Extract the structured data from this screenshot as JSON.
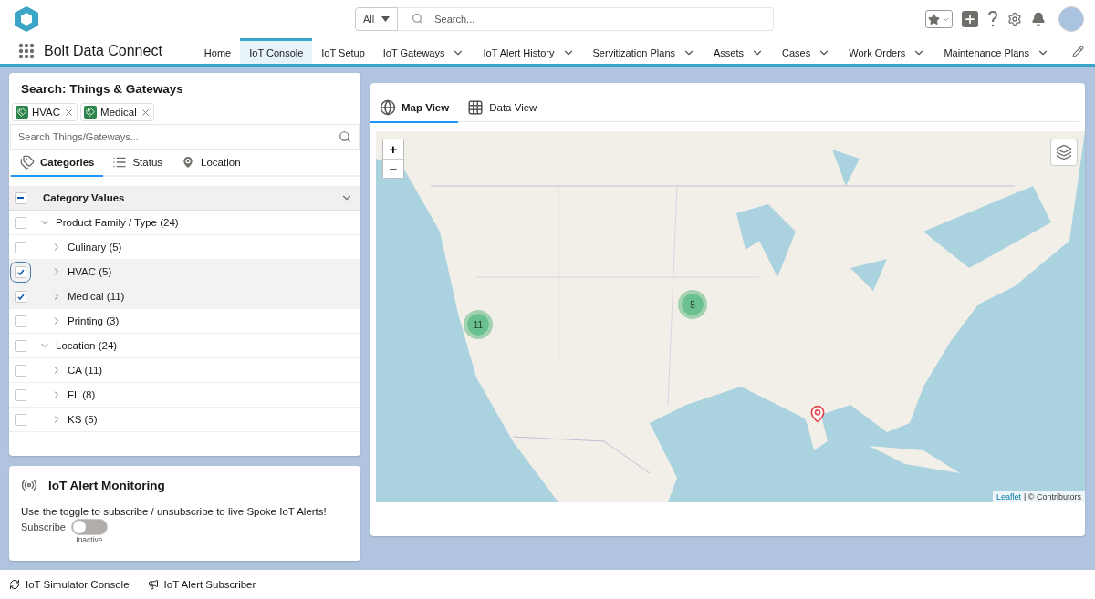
{
  "header": {
    "scope": "All",
    "search_placeholder": "Search..."
  },
  "app_name": "Bolt Data Connect",
  "nav_tabs": [
    {
      "label": "Home",
      "selected": false,
      "has_menu": false
    },
    {
      "label": "IoT Console",
      "selected": true,
      "has_menu": false
    },
    {
      "label": "IoT Setup",
      "selected": false,
      "has_menu": false
    },
    {
      "label": "IoT Gateways",
      "selected": false,
      "has_menu": true
    },
    {
      "label": "IoT Alert History",
      "selected": false,
      "has_menu": true
    },
    {
      "label": "Servitization Plans",
      "selected": false,
      "has_menu": true
    },
    {
      "label": "Assets",
      "selected": false,
      "has_menu": true
    },
    {
      "label": "Cases",
      "selected": false,
      "has_menu": true
    },
    {
      "label": "Work Orders",
      "selected": false,
      "has_menu": true
    },
    {
      "label": "Maintenance Plans",
      "selected": false,
      "has_menu": true
    }
  ],
  "search_panel": {
    "title": "Search: Things & Gateways",
    "pills": [
      {
        "label": "HVAC"
      },
      {
        "label": "Medical"
      }
    ],
    "placeholder": "Search Things/Gateways...",
    "tabs": [
      {
        "label": "Categories",
        "kind": "categories",
        "selected": true
      },
      {
        "label": "Status",
        "kind": "status",
        "selected": false
      },
      {
        "label": "Location",
        "kind": "location",
        "selected": false
      }
    ],
    "tree_header": {
      "label": "Category Values",
      "indeterminate": true,
      "expanded": true
    },
    "tree": [
      {
        "label": "Product Family / Type (24)",
        "checked": false,
        "expanded": true,
        "children": [
          {
            "label": "Culinary (5)",
            "checked": false,
            "expanded": false
          },
          {
            "label": "HVAC (5)",
            "checked": true,
            "expanded": false
          },
          {
            "label": "Medical (11)",
            "checked": true,
            "expanded": false
          },
          {
            "label": "Printing (3)",
            "checked": false,
            "expanded": false
          }
        ]
      },
      {
        "label": "Location (24)",
        "checked": false,
        "expanded": true,
        "children": [
          {
            "label": "CA (11)",
            "checked": false,
            "expanded": false
          },
          {
            "label": "FL (8)",
            "checked": false,
            "expanded": false
          },
          {
            "label": "KS (5)",
            "checked": false,
            "expanded": false
          }
        ]
      }
    ]
  },
  "alert_card": {
    "title": "IoT Alert Monitoring",
    "text": "Use the toggle to subscribe / unsubscribe to live Spoke IoT Alerts!",
    "toggle_label": "Subscribe",
    "on": false,
    "status": "Inactive"
  },
  "map_panel": {
    "tabs": [
      {
        "label": "Map View",
        "kind": "map",
        "selected": true
      },
      {
        "label": "Data View",
        "kind": "data",
        "selected": false
      }
    ],
    "zoom_in": "+",
    "zoom_out": "−",
    "clusters": [
      {
        "count": "11"
      },
      {
        "count": "5"
      }
    ],
    "attribution_link": "Leaflet",
    "attribution_text": "| © Contributors"
  },
  "utility_bar": [
    {
      "label": "IoT Simulator Console",
      "kind": "simulator"
    },
    {
      "label": "IoT Alert Subscriber",
      "kind": "subscriber"
    }
  ]
}
